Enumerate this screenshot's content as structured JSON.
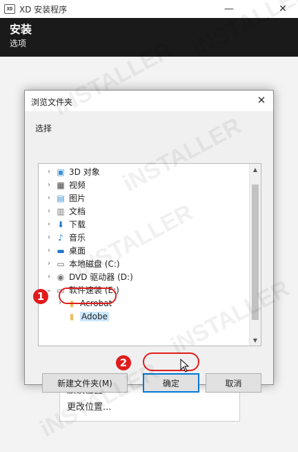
{
  "titlebar": {
    "app_icon_text": "XD",
    "title": "XD 安装程序",
    "minimize": "—",
    "close": "✕"
  },
  "header": {
    "title": "安装",
    "subtitle": "选项"
  },
  "location": {
    "items": [
      "默认位置",
      "更改位置..."
    ]
  },
  "dialog": {
    "title": "浏览文件夹",
    "close": "✕",
    "label": "选择",
    "tree": [
      {
        "label": "3D 对象",
        "icon": "3d-objects-icon",
        "expandable": true,
        "indent": 0
      },
      {
        "label": "视频",
        "icon": "video-icon",
        "expandable": true,
        "indent": 0
      },
      {
        "label": "图片",
        "icon": "pictures-icon",
        "expandable": true,
        "indent": 0
      },
      {
        "label": "文档",
        "icon": "documents-icon",
        "expandable": true,
        "indent": 0
      },
      {
        "label": "下载",
        "icon": "downloads-icon",
        "expandable": true,
        "indent": 0
      },
      {
        "label": "音乐",
        "icon": "music-icon",
        "expandable": true,
        "indent": 0
      },
      {
        "label": "桌面",
        "icon": "desktop-icon",
        "expandable": true,
        "indent": 0
      },
      {
        "label": "本地磁盘 (C:)",
        "icon": "drive-icon",
        "expandable": true,
        "indent": 0
      },
      {
        "label": "DVD 驱动器 (D:)",
        "icon": "dvd-icon",
        "expandable": true,
        "indent": 0
      },
      {
        "label": "软件速装 (E:)",
        "icon": "drive-icon",
        "expandable": false,
        "indent": 0
      },
      {
        "label": "Acrobat",
        "icon": "folder-icon",
        "expandable": true,
        "indent": 1
      },
      {
        "label": "Adobe",
        "icon": "folder-icon",
        "expandable": false,
        "indent": 1,
        "selected": true
      }
    ],
    "buttons": {
      "new_folder": "新建文件夹(M)",
      "ok": "确定",
      "cancel": "取消"
    }
  },
  "annotations": {
    "step1": "1",
    "step2": "2"
  },
  "watermark": "iNSTALLER",
  "colors": {
    "accent": "#0078d7",
    "annotation": "#e11b1b",
    "selection": "#cce8ff",
    "header_bg": "#1a1a1a"
  }
}
